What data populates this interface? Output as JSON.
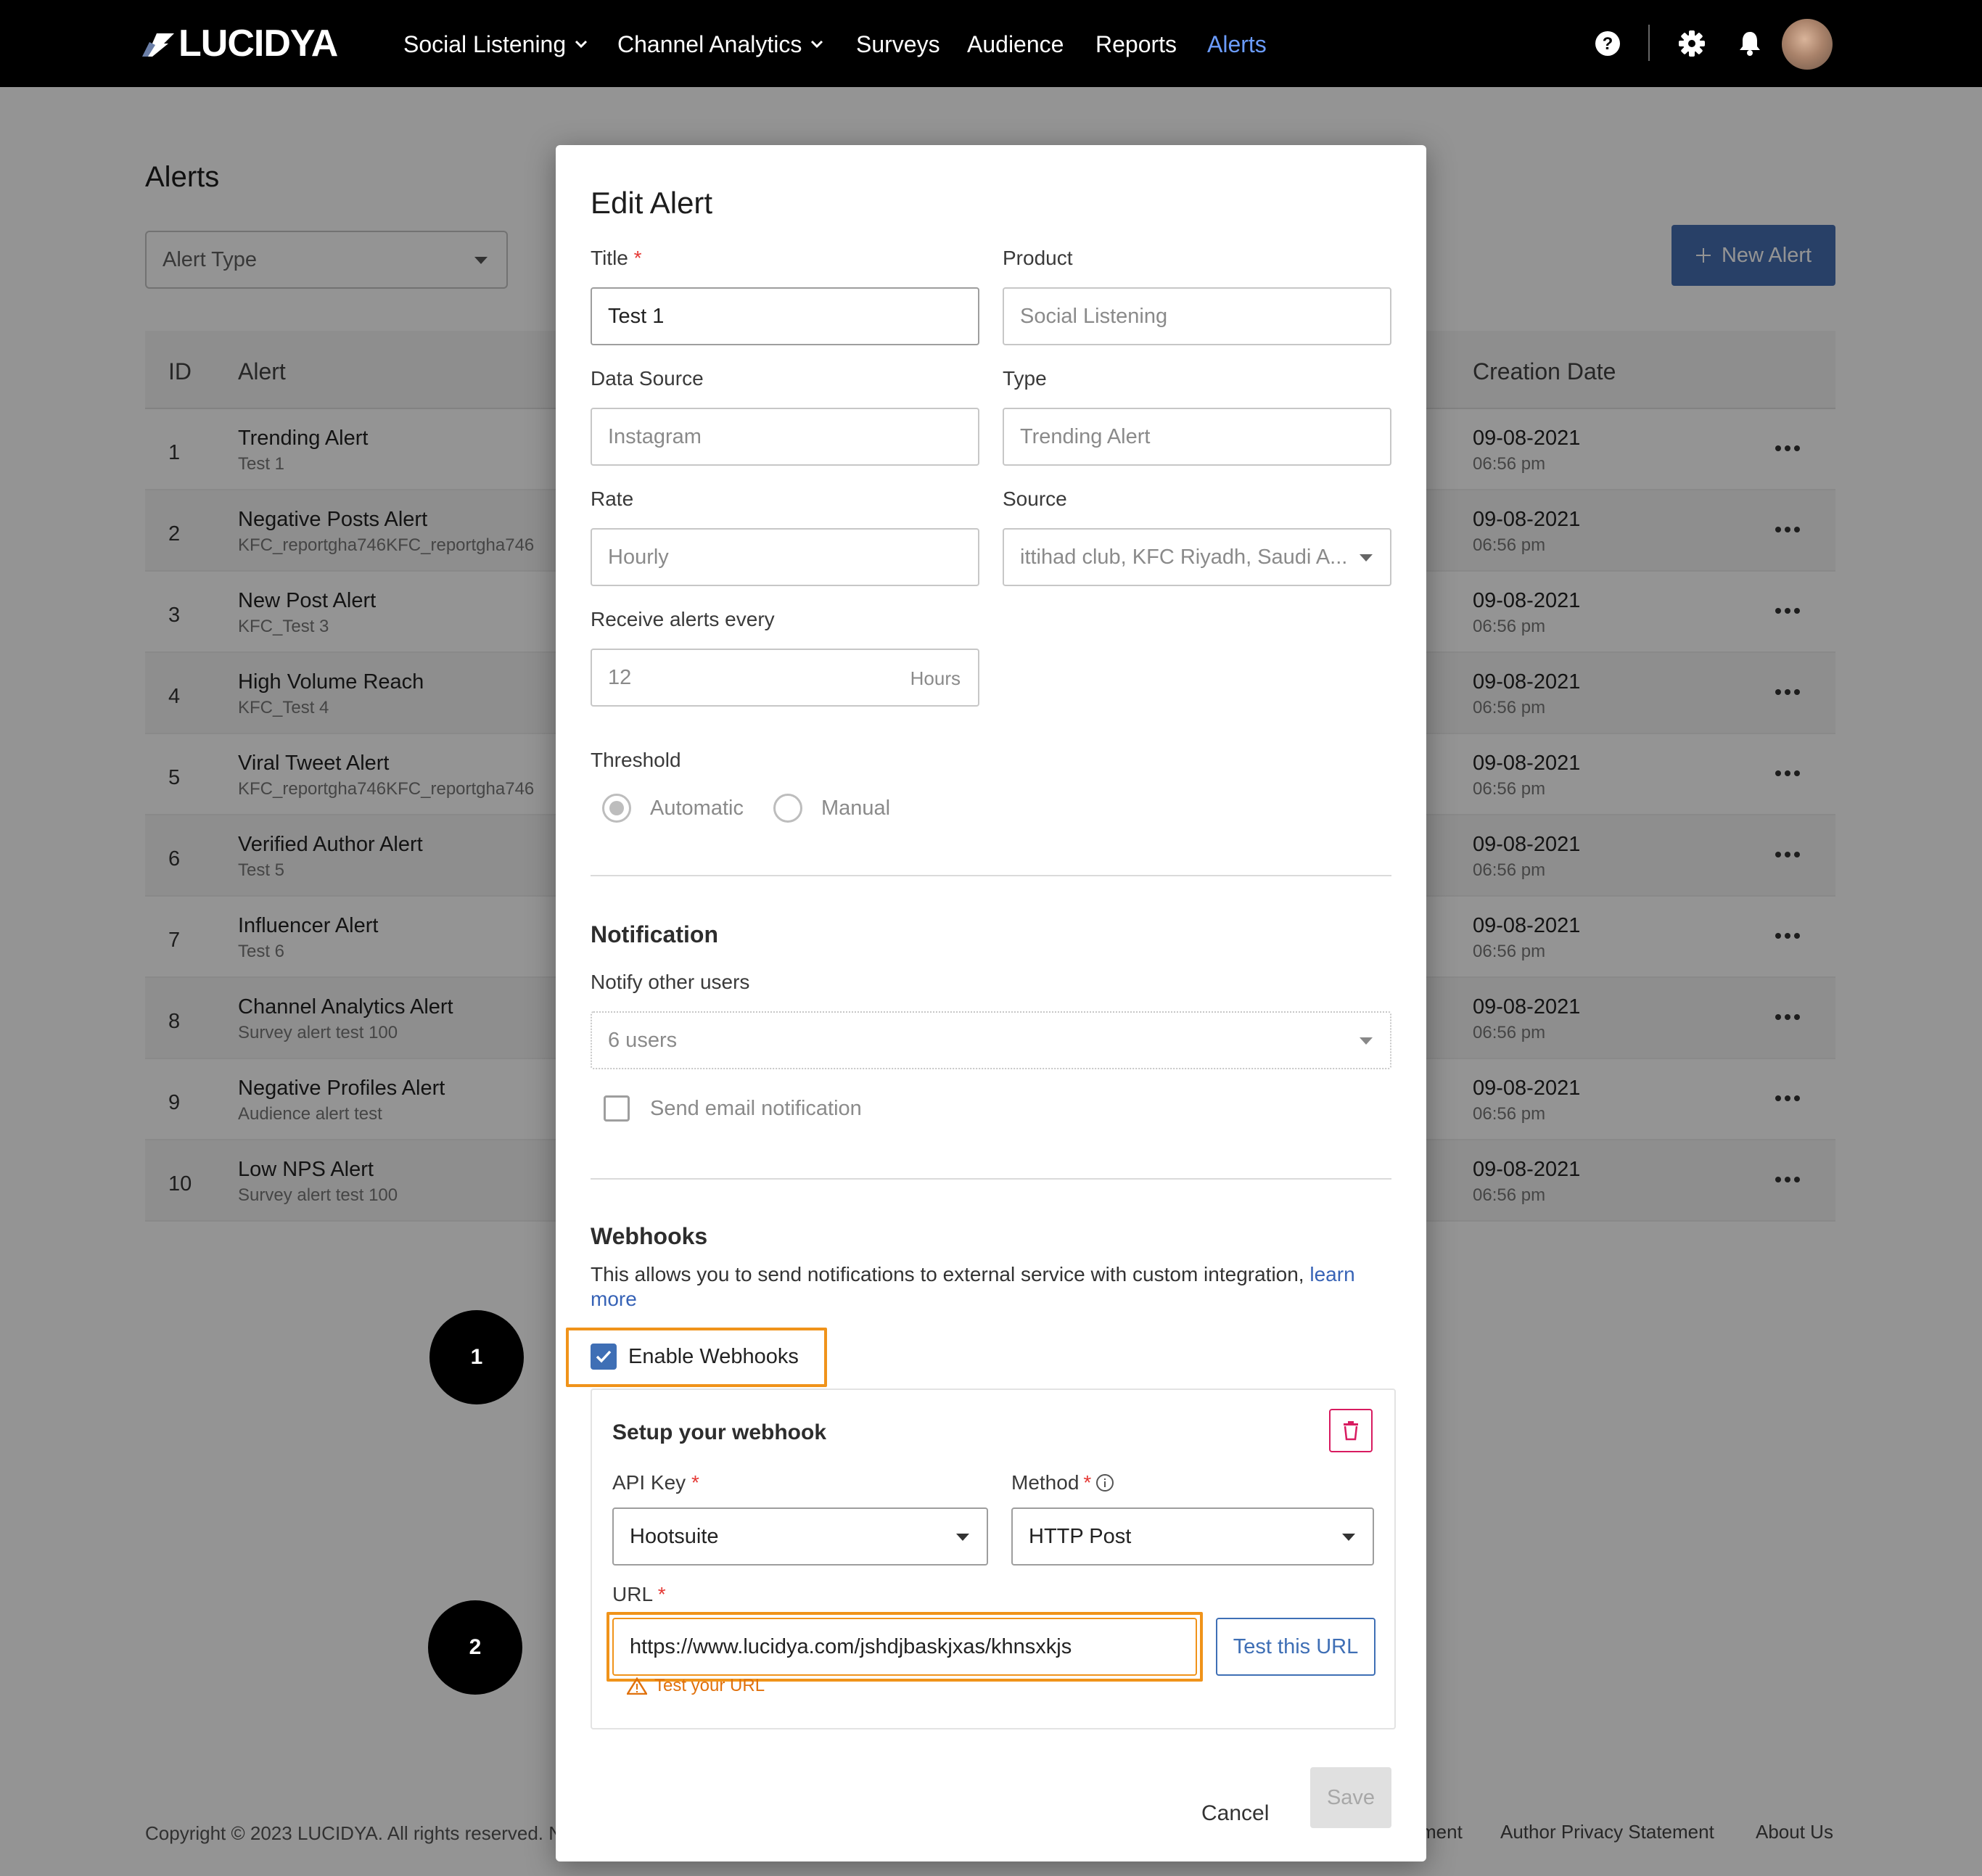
{
  "nav": {
    "logo": "LUCIDYA",
    "items": [
      {
        "label": "Social Listening"
      },
      {
        "label": "Channel Analytics"
      },
      {
        "label": "Surveys"
      },
      {
        "label": "Audience"
      },
      {
        "label": "Reports"
      },
      {
        "label": "Alerts"
      }
    ],
    "active_item": "Alerts",
    "icons": [
      "help-icon",
      "gear-icon",
      "bell-icon",
      "avatar"
    ]
  },
  "page": {
    "title": "Alerts",
    "filter_placeholder": "Alert Type",
    "new_alert_label": "New Alert"
  },
  "table": {
    "headers": {
      "id": "ID",
      "alert": "Alert",
      "creation_date": "Creation Date"
    },
    "rows": [
      {
        "id": "1",
        "name": "Trending Alert",
        "sub": "Test 1",
        "date": "09-08-2021",
        "time": "06:56 pm"
      },
      {
        "id": "2",
        "name": "Negative Posts Alert",
        "sub": "KFC_reportgha746KFC_reportgha746",
        "date": "09-08-2021",
        "time": "06:56 pm"
      },
      {
        "id": "3",
        "name": "New Post Alert",
        "sub": "KFC_Test 3",
        "date": "09-08-2021",
        "time": "06:56 pm"
      },
      {
        "id": "4",
        "name": "High Volume Reach",
        "sub": "KFC_Test 4",
        "date": "09-08-2021",
        "time": "06:56 pm"
      },
      {
        "id": "5",
        "name": "Viral Tweet Alert",
        "sub": "KFC_reportgha746KFC_reportgha746",
        "date": "09-08-2021",
        "time": "06:56 pm"
      },
      {
        "id": "6",
        "name": "Verified Author Alert",
        "sub": "Test 5",
        "date": "09-08-2021",
        "time": "06:56 pm"
      },
      {
        "id": "7",
        "name": "Influencer Alert",
        "sub": "Test 6",
        "date": "09-08-2021",
        "time": "06:56 pm"
      },
      {
        "id": "8",
        "name": "Channel Analytics Alert",
        "sub": "Survey alert test 100",
        "date": "09-08-2021",
        "time": "06:56 pm"
      },
      {
        "id": "9",
        "name": "Negative Profiles Alert",
        "sub": "Audience alert test",
        "date": "09-08-2021",
        "time": "06:56 pm"
      },
      {
        "id": "10",
        "name": "Low NPS Alert",
        "sub": "Survey alert test 100",
        "date": "09-08-2021",
        "time": "06:56 pm"
      }
    ]
  },
  "footer": {
    "copyright": "Copyright © 2023 LUCIDYA. All rights reserved. N",
    "links": [
      "ment",
      "Author Privacy Statement",
      "About Us"
    ]
  },
  "steps": [
    "1",
    "2"
  ],
  "modal": {
    "title": "Edit Alert",
    "title_label": "Title",
    "title_value": "Test 1",
    "product_label": "Product",
    "product_value": "Social Listening",
    "data_source_label": "Data Source",
    "data_source_value": "Instagram",
    "type_label": "Type",
    "type_value": "Trending Alert",
    "rate_label": "Rate",
    "rate_value": "Hourly",
    "source_label": "Source",
    "source_value": "ittihad club, KFC Riyadh, Saudi A...",
    "receive_label": "Receive alerts every",
    "receive_value": "12",
    "receive_unit": "Hours",
    "threshold_label": "Threshold",
    "threshold_options": [
      "Automatic",
      "Manual"
    ],
    "threshold_selected": "Automatic",
    "notification_title": "Notification",
    "notify_label": "Notify other users",
    "notify_value": "6 users",
    "email_label": "Send email notification",
    "email_checked": false,
    "webhooks_title": "Webhooks",
    "webhooks_desc": "This allows you to send notifications to external service with custom integration, ",
    "webhooks_link": "learn more",
    "enable_label": "Enable Webhooks",
    "enable_checked": true,
    "setup_title": "Setup your webhook",
    "api_key_label": "API Key",
    "api_key_value": "Hootsuite",
    "method_label": "Method",
    "method_value": "HTTP Post",
    "url_label": "URL",
    "url_value": "https://www.lucidya.com/jshdjbaskjxas/khnsxkjs",
    "test_url_label": "Test this URL",
    "warning": "Test your URL",
    "cancel_label": "Cancel",
    "save_label": "Save"
  },
  "colors": {
    "accent": "#3f6fb5",
    "nav_active": "#6b9cff",
    "highlight": "#f0931a",
    "warning": "#e0710c",
    "danger": "#d81b60"
  }
}
